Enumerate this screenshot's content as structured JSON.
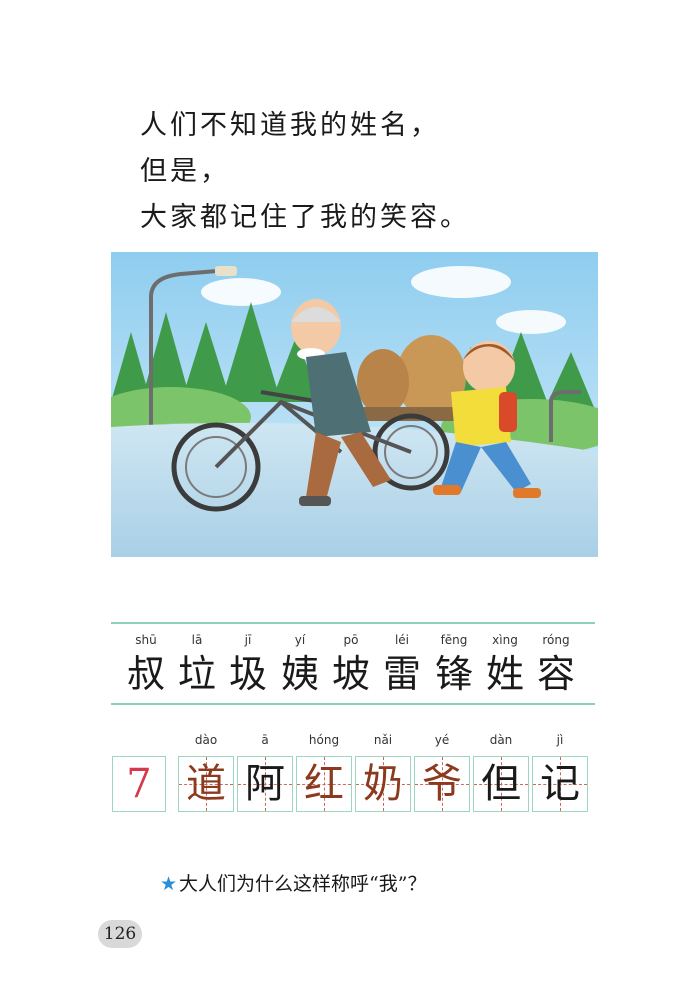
{
  "poem": {
    "lines": [
      "人们不知道我的姓名，",
      "但是，",
      "大家都记住了我的笑容。"
    ]
  },
  "vocab_read": [
    {
      "pinyin": "shū",
      "char": "叔"
    },
    {
      "pinyin": "lā",
      "char": "垃"
    },
    {
      "pinyin": "jī",
      "char": "圾"
    },
    {
      "pinyin": "yí",
      "char": "姨"
    },
    {
      "pinyin": "pō",
      "char": "坡"
    },
    {
      "pinyin": "léi",
      "char": "雷"
    },
    {
      "pinyin": "fēng",
      "char": "锋"
    },
    {
      "pinyin": "xìng",
      "char": "姓"
    },
    {
      "pinyin": "róng",
      "char": "容"
    }
  ],
  "lesson_number": "7",
  "vocab_write": [
    {
      "pinyin": "dào",
      "char": "道",
      "color": "#8b3a1e"
    },
    {
      "pinyin": "ā",
      "char": "阿",
      "color": "#1a1a1a"
    },
    {
      "pinyin": "hóng",
      "char": "红",
      "color": "#8b3a1e"
    },
    {
      "pinyin": "nǎi",
      "char": "奶",
      "color": "#8b3a1e"
    },
    {
      "pinyin": "yé",
      "char": "爷",
      "color": "#8b3a1e"
    },
    {
      "pinyin": "dàn",
      "char": "但",
      "color": "#1a1a1a"
    },
    {
      "pinyin": "jì",
      "char": "记",
      "color": "#1a1a1a"
    }
  ],
  "question": {
    "star_icon": "★",
    "text": "大人们为什么这样称呼“我”？"
  },
  "page_number": "126"
}
